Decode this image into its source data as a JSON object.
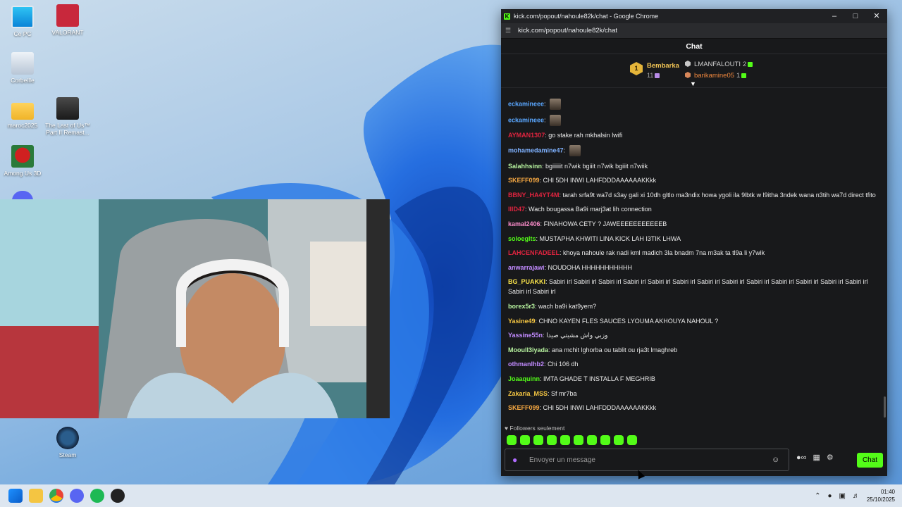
{
  "desktop": {
    "icons": [
      {
        "label": "Ce PC"
      },
      {
        "label": "VALORANT"
      },
      {
        "label": "Corbeille"
      },
      {
        "label": "maroc2025"
      },
      {
        "label": "The Last of Us™ Part II Remast..."
      },
      {
        "label": "Among Us 3D"
      },
      {
        "label": "Steam"
      }
    ]
  },
  "browser": {
    "window_title": "kick.com/popout/nahoule82k/chat - Google Chrome",
    "url": "kick.com/popout/nahoule82k/chat"
  },
  "chat": {
    "header": "Chat",
    "leaderboard": {
      "first": {
        "rank": "1",
        "name": "Bembarka",
        "count": "11"
      },
      "second": {
        "name": "LMANFALOUTI",
        "count": "2"
      },
      "third": {
        "name": "barikamine05",
        "count": "1"
      }
    },
    "messages": [
      {
        "user": "eckamineee",
        "color": "#5aa7ff",
        "text": "",
        "emote": true
      },
      {
        "user": "eckamineee",
        "color": "#5aa7ff",
        "text": "",
        "emote": true
      },
      {
        "user": "AYMAN1307",
        "color": "#e0243f",
        "text": "go stake rah mkhalsin lwifi"
      },
      {
        "user": "mohamedamine47",
        "color": "#7fb2ff",
        "text": "",
        "emote": true
      },
      {
        "user": "Salahhsinn",
        "color": "#b9f5a1",
        "text": "bgiiiiiit n7wik bgiiit n7wik bgiiit n7wiik"
      },
      {
        "user": "SKEFF099",
        "color": "#f4a742",
        "text": "CHI 5DH INWI LAHFDDDAAAAAAKKkk"
      },
      {
        "user": "BBNY_HA4YT4M",
        "color": "#e0243f",
        "text": "tarah srfa9t wa7d s3ay gali xi 10dh gltlo ma3ndix howa ygoli ila 9lbtk w l9itha 3ndek wana n3tih wa7d direct tfito"
      },
      {
        "user": "lllD47",
        "color": "#e0243f",
        "text": "Wach bougassa Ba9i marj3at lih connection"
      },
      {
        "user": "kamal2406",
        "color": "#f98bc8",
        "text": "FINAHOWA CETY ? JAWEEEEEEEEEEEB"
      },
      {
        "user": "soloeglts",
        "color": "#53fc18",
        "text": "MUSTAPHA KHWITI LINA KICK LAH I3TIK LHWA"
      },
      {
        "user": "LAHCENFADEEL",
        "color": "#e0243f",
        "text": "khoya nahoule rak nadi kml madich 3la bnadm 7na m3ak ta tl9a li y7wik"
      },
      {
        "user": "anwarrajawi",
        "color": "#c28bff",
        "text": "NOUDOHA HHHHHHHHHHH"
      },
      {
        "user": "BG_PUAKKI",
        "color": "#f7e14a",
        "text": "Sabiri irl Sabiri irl Sabiri irl Sabiri irl Sabiri irl Sabiri irl Sabiri irl Sabiri irl Sabiri irl Sabiri irl Sabiri irl Sabiri irl Sabiri irl Sabiri irl Sabiri irl"
      },
      {
        "user": "borex5r3",
        "color": "#b9f5a1",
        "text": "wach ba9i kat9yem?"
      },
      {
        "user": "Yasine49",
        "color": "#f4c542",
        "text": "CHNO KAYEN FLES SAUCES LYOUMA AKHOUYA NAHOUL ?"
      },
      {
        "user": "Yassine55n",
        "color": "#c28bff",
        "text": "وزبي واش مشيتي صيدا"
      },
      {
        "user": "Mooull3iyada",
        "color": "#b9f5a1",
        "text": "ana mchit lghorba ou tablit ou rja3t lmaghreb"
      },
      {
        "user": "othmanlhb2",
        "color": "#c28bff",
        "text": "Chi 106 dh"
      },
      {
        "user": "Joaaquinn",
        "color": "#53fc18",
        "text": "IMTA GHADE T INSTALLA F MEGHRIB"
      },
      {
        "user": "Zakaria_MSS",
        "color": "#f4c542",
        "text": "Sf mr7ba"
      },
      {
        "user": "SKEFF099",
        "color": "#f4a742",
        "text": "CHI 5DH INWI LAHFDDDAAAAAAKKkk"
      }
    ],
    "followers_only": "Followers seulement",
    "input_placeholder": "Envoyer un message",
    "send_label": "Chat"
  },
  "taskbar": {
    "time": "01:40",
    "date": "25/10/2025"
  }
}
